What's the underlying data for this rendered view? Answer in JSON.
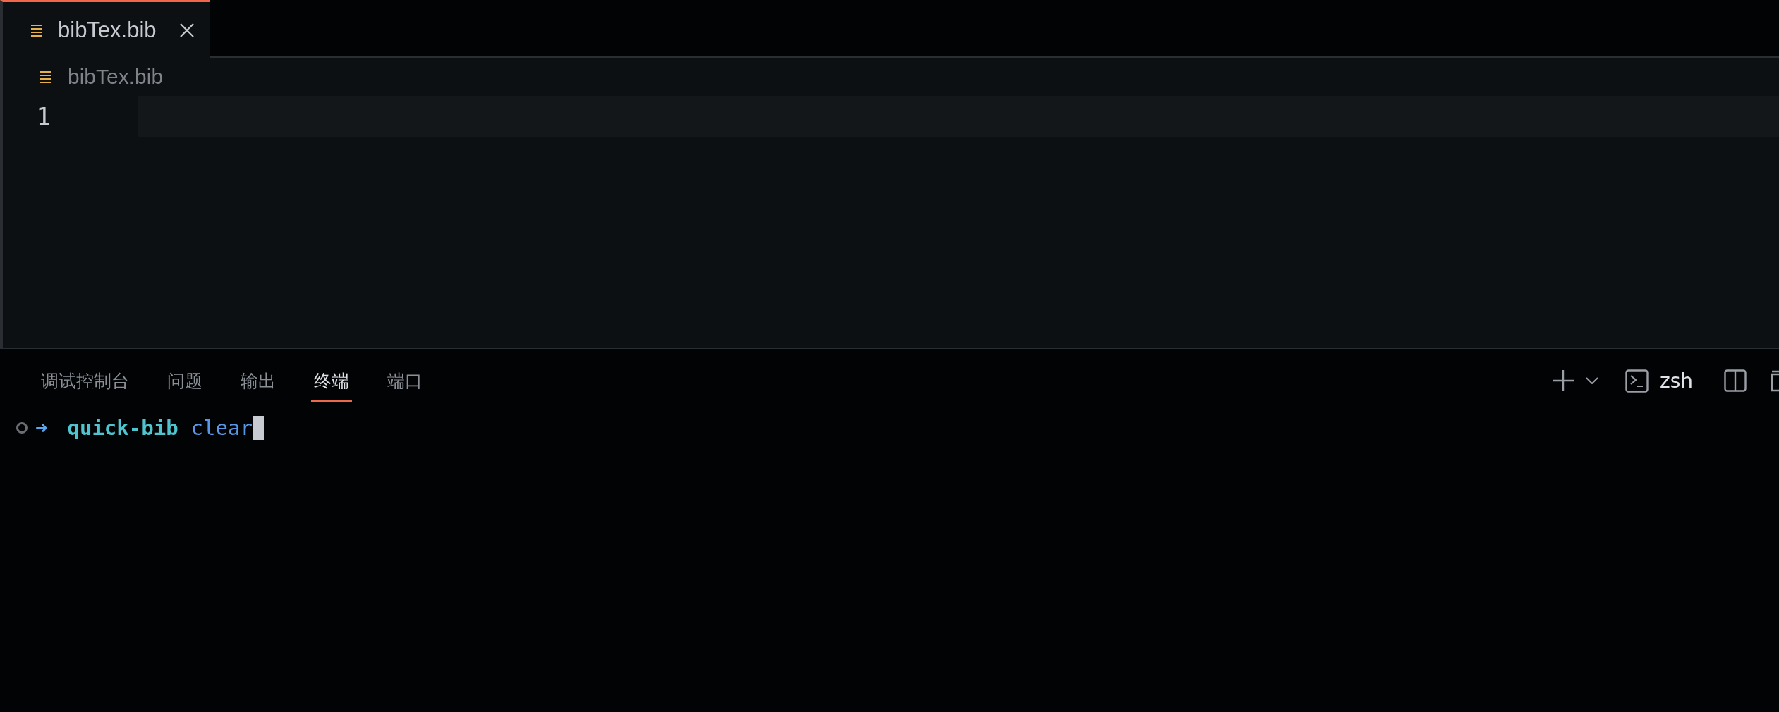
{
  "editor_tabs": [
    {
      "label": "bibTex.bib",
      "selected": true
    }
  ],
  "breadcrumb": "bibTex.bib",
  "editor": {
    "line_numbers": [
      "1"
    ]
  },
  "panel_tabs": [
    {
      "label": "调试控制台",
      "selected": false
    },
    {
      "label": "问题",
      "selected": false
    },
    {
      "label": "输出",
      "selected": false
    },
    {
      "label": "终端",
      "selected": true
    },
    {
      "label": "端口",
      "selected": false
    }
  ],
  "panel_toolbar": {
    "shell": "zsh"
  },
  "terminal": {
    "prompt_symbol": "➜",
    "directory": "quick-bib",
    "command": "clear"
  }
}
